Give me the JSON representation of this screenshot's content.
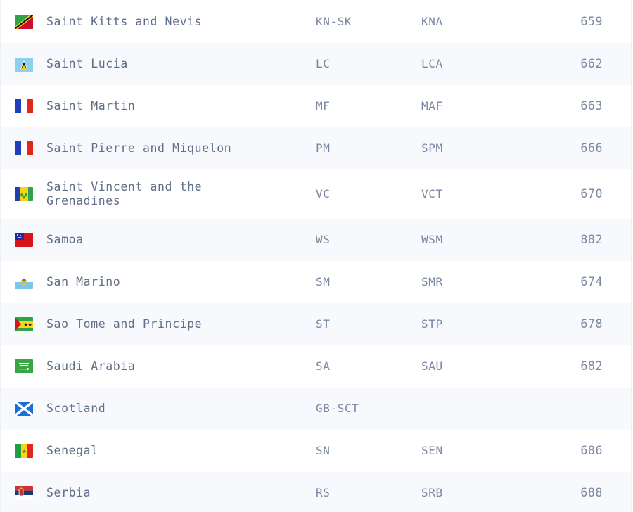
{
  "rows": [
    {
      "name": "Saint Kitts and Nevis",
      "code": "KN-SK",
      "alpha3": "KNA",
      "numeric": "659",
      "flag": "saint-kitts-flag-icon"
    },
    {
      "name": "Saint Lucia",
      "code": "LC",
      "alpha3": "LCA",
      "numeric": "662",
      "flag": "saint-lucia-flag-icon"
    },
    {
      "name": "Saint Martin",
      "code": "MF",
      "alpha3": "MAF",
      "numeric": "663",
      "flag": "france-flag-icon"
    },
    {
      "name": "Saint Pierre and Miquelon",
      "code": "PM",
      "alpha3": "SPM",
      "numeric": "666",
      "flag": "france-flag-icon"
    },
    {
      "name": "Saint Vincent and the Grenadines",
      "code": "VC",
      "alpha3": "VCT",
      "numeric": "670",
      "flag": "saint-vincent-flag-icon"
    },
    {
      "name": "Samoa",
      "code": "WS",
      "alpha3": "WSM",
      "numeric": "882",
      "flag": "samoa-flag-icon"
    },
    {
      "name": "San Marino",
      "code": "SM",
      "alpha3": "SMR",
      "numeric": "674",
      "flag": "san-marino-flag-icon"
    },
    {
      "name": "Sao Tome and Principe",
      "code": "ST",
      "alpha3": "STP",
      "numeric": "678",
      "flag": "sao-tome-flag-icon"
    },
    {
      "name": "Saudi Arabia",
      "code": "SA",
      "alpha3": "SAU",
      "numeric": "682",
      "flag": "saudi-arabia-flag-icon"
    },
    {
      "name": "Scotland",
      "code": "GB-SCT",
      "alpha3": "",
      "numeric": "",
      "flag": "scotland-flag-icon"
    },
    {
      "name": "Senegal",
      "code": "SN",
      "alpha3": "SEN",
      "numeric": "686",
      "flag": "senegal-flag-icon"
    },
    {
      "name": "Serbia",
      "code": "RS",
      "alpha3": "SRB",
      "numeric": "688",
      "flag": "serbia-flag-icon"
    }
  ],
  "colors": {
    "text": "#5f6f88",
    "muted": "#7a88a2",
    "stripe": "#f8f9fc",
    "border": "#eef0f6"
  }
}
